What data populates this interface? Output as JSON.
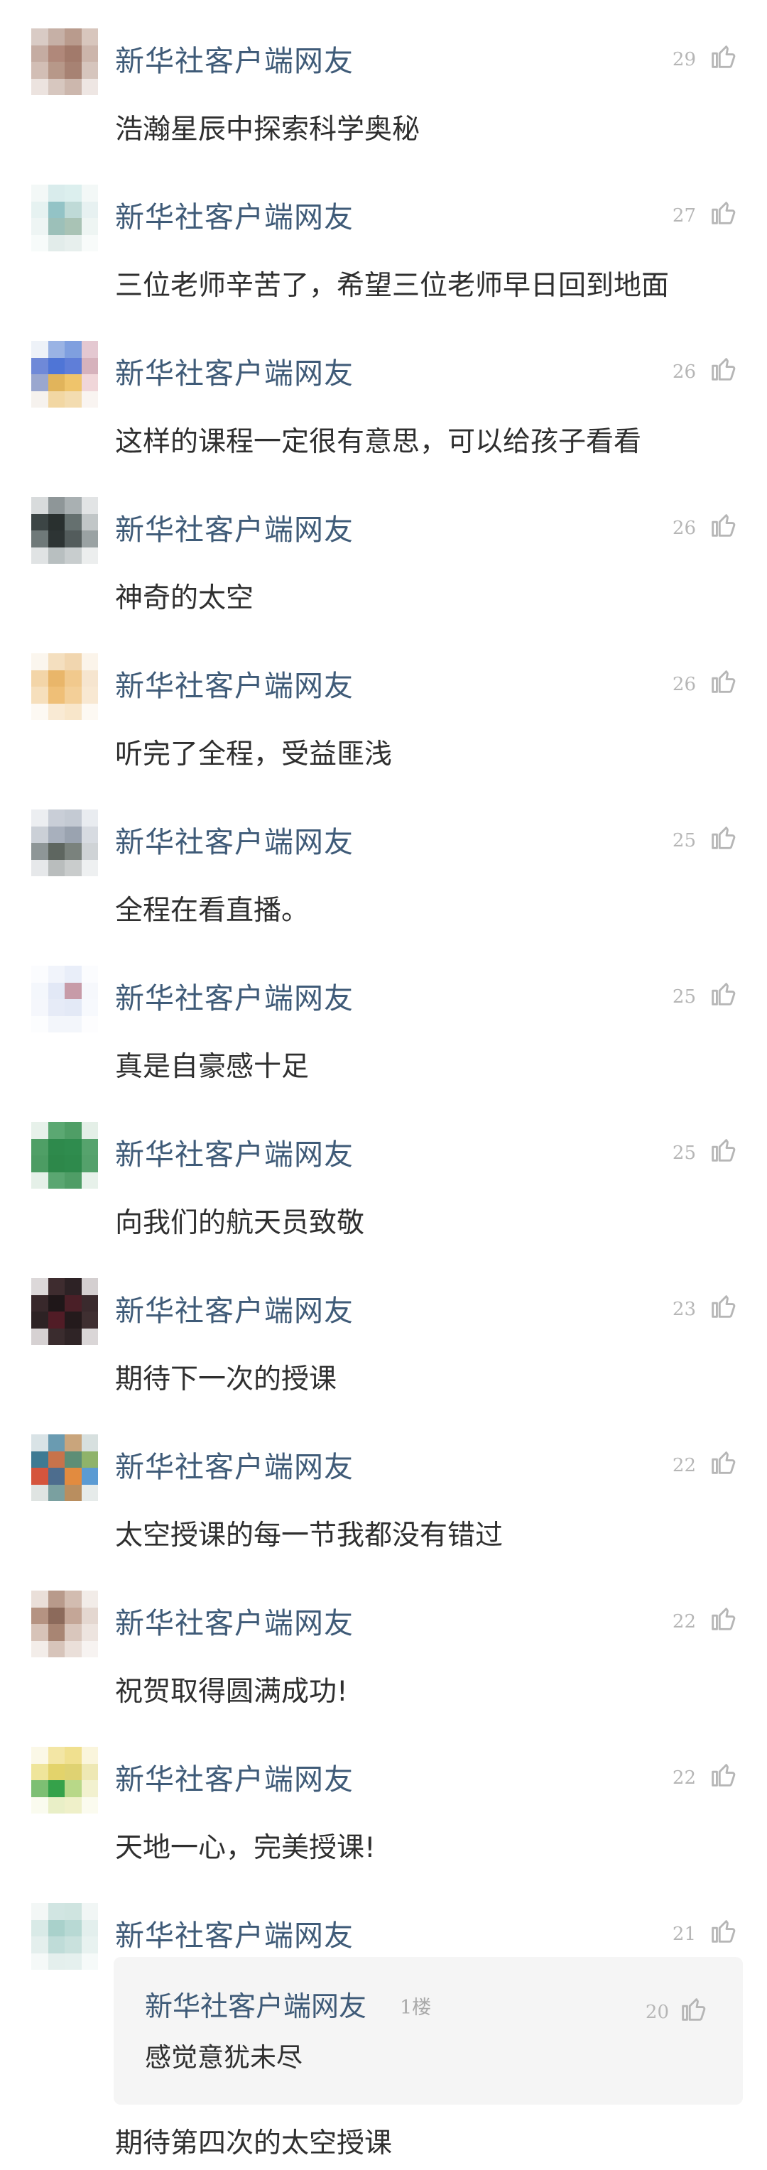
{
  "comments": [
    {
      "user": "新华社客户端网友",
      "likes": "29",
      "text": "浩瀚星辰中探索科学奥秘",
      "avatar_icon": "blurred-user-avatar",
      "avatar_colors": [
        "#d9cbc5",
        "#c6b0a6",
        "#b99b8d",
        "#d8c6bd",
        "#c5aca2",
        "#b0887a",
        "#a27a6b",
        "#ccb5ab",
        "#d2beb5",
        "#b79889",
        "#a78273",
        "#d6c5bd",
        "#ece3df",
        "#d7c7bf",
        "#ccb7ad",
        "#eee6e3"
      ]
    },
    {
      "user": "新华社客户端网友",
      "likes": "27",
      "text": "三位老师辛苦了，希望三位老师早日回到地面",
      "avatar_icon": "blurred-user-avatar",
      "avatar_colors": [
        "#f3f8f7",
        "#d9ecec",
        "#dcefee",
        "#f3f8f7",
        "#e6f2f1",
        "#93c3c6",
        "#bfdad7",
        "#e7f1f1",
        "#eef5f4",
        "#9cc0b9",
        "#a9c3b5",
        "#eef5f3",
        "#f7fbfa",
        "#e2ecea",
        "#e7efed",
        "#f8fbfa"
      ]
    },
    {
      "user": "新华社客户端网友",
      "likes": "26",
      "text": "这样的课程一定很有意思，可以给孩子看看",
      "avatar_icon": "blurred-user-avatar",
      "avatar_colors": [
        "#eef2f8",
        "#9ab3e4",
        "#7f9fdf",
        "#e4c8d1",
        "#6f89d8",
        "#4f75d6",
        "#5f7ed8",
        "#d6b2bc",
        "#9aa7cf",
        "#e1b45b",
        "#efc46b",
        "#f0d6d9",
        "#f6f2ee",
        "#f2d7a3",
        "#f3dcb0",
        "#f9f4f1"
      ]
    },
    {
      "user": "新华社客户端网友",
      "likes": "26",
      "text": "神奇的太空",
      "avatar_icon": "blurred-user-avatar",
      "avatar_colors": [
        "#d8dbdc",
        "#8e9698",
        "#a9b0b2",
        "#e2e4e5",
        "#3c4545",
        "#29302f",
        "#65706f",
        "#c1c6c7",
        "#6f7979",
        "#2d3434",
        "#535c5c",
        "#9aa2a3",
        "#e0e3e4",
        "#b8bfc0",
        "#c8cdce",
        "#eceeee"
      ]
    },
    {
      "user": "新华社客户端网友",
      "likes": "26",
      "text": "听完了全程，受益匪浅",
      "avatar_icon": "blurred-user-avatar",
      "avatar_colors": [
        "#fbf6ee",
        "#f4dfbf",
        "#f1d6af",
        "#fbf4ea",
        "#f3d5a8",
        "#e9b66a",
        "#f1c98d",
        "#f6e5cf",
        "#f6dfbc",
        "#efbf77",
        "#f3cf98",
        "#f8e8d2",
        "#fdf9f3",
        "#f9ead4",
        "#f8e6ca",
        "#fdf9f3"
      ]
    },
    {
      "user": "新华社客户端网友",
      "likes": "25",
      "text": "全程在看直播。",
      "avatar_icon": "blurred-user-avatar",
      "avatar_colors": [
        "#eceef1",
        "#c9ced7",
        "#c4cad3",
        "#e9ecf0",
        "#cbd0d7",
        "#a8b0bd",
        "#9aa3b0",
        "#d7dbe1",
        "#8e9697",
        "#5e6660",
        "#7a827d",
        "#cfd3d6",
        "#e6e8ea",
        "#b9bdbd",
        "#c9cccc",
        "#eef0f1"
      ]
    },
    {
      "user": "新华社客户端网友",
      "likes": "25",
      "text": "真是自豪感十足",
      "avatar_icon": "blurred-user-avatar",
      "avatar_colors": [
        "#fbfcfe",
        "#f1f4fb",
        "#e9eef9",
        "#fbfcfe",
        "#f4f7fc",
        "#e2e8f6",
        "#c79ba8",
        "#f6f8fc",
        "#f5f7fc",
        "#e6ebf7",
        "#e3e9f6",
        "#f7f9fd",
        "#fcfdfe",
        "#f3f6fb",
        "#f3f6fb",
        "#fdfdfe"
      ]
    },
    {
      "user": "新华社客户端网友",
      "likes": "25",
      "text": "向我们的航天员致敬",
      "avatar_icon": "blurred-user-avatar",
      "avatar_colors": [
        "#e7f1ea",
        "#5ba872",
        "#4f9e66",
        "#e4efe7",
        "#4f9f66",
        "#2e8a4c",
        "#2f8c4e",
        "#56a36d",
        "#4c9c63",
        "#2d884a",
        "#2e8a4c",
        "#54a16b",
        "#e5f0e8",
        "#5aa671",
        "#4f9d66",
        "#e7f1ea"
      ]
    },
    {
      "user": "新华社客户端网友",
      "likes": "23",
      "text": "期待下一次的授课",
      "avatar_icon": "blurred-user-avatar",
      "avatar_colors": [
        "#dcd8d9",
        "#3e2c2f",
        "#2d2225",
        "#d4cfd0",
        "#38282b",
        "#1f1719",
        "#4a1f27",
        "#3a2a2d",
        "#2d2224",
        "#511c26",
        "#241a1c",
        "#3f2f31",
        "#d6d1d2",
        "#3a2c2e",
        "#2f2426",
        "#dad6d7"
      ]
    },
    {
      "user": "新华社客户端网友",
      "likes": "22",
      "text": "太空授课的每一节我都没有错过",
      "avatar_icon": "blurred-user-avatar",
      "avatar_colors": [
        "#d9e3e6",
        "#6a9bb1",
        "#c9a57c",
        "#d7e0df",
        "#3e7a93",
        "#c7734b",
        "#5d8e76",
        "#8fb36a",
        "#d5553d",
        "#4d6d8e",
        "#e28b3f",
        "#5b9bd3",
        "#dfe4e2",
        "#7aa0a0",
        "#b98e5f",
        "#e6ebea"
      ]
    },
    {
      "user": "新华社客户端网友",
      "likes": "22",
      "text": "祝贺取得圆满成功!",
      "avatar_icon": "blurred-user-avatar",
      "avatar_colors": [
        "#eadfd9",
        "#b89a8b",
        "#d2bcb0",
        "#f2ece8",
        "#b59382",
        "#8c6a5b",
        "#c4a697",
        "#e4d7d0",
        "#d7c3b8",
        "#a88573",
        "#d9c6bc",
        "#ede4df",
        "#f3ede9",
        "#d7c4ba",
        "#eadfd9",
        "#f7f3f1"
      ]
    },
    {
      "user": "新华社客户端网友",
      "likes": "22",
      "text": "天地一心，完美授课!",
      "avatar_icon": "blurred-user-avatar",
      "avatar_colors": [
        "#fbf8e7",
        "#f3e6a5",
        "#f0e08f",
        "#faf5dc",
        "#efe59b",
        "#e3d36b",
        "#dfd272",
        "#eee8b4",
        "#7dbf73",
        "#35a24a",
        "#b8d888",
        "#f2f1cf",
        "#fafbef",
        "#e9efc7",
        "#eff0c9",
        "#fbfbef"
      ]
    },
    {
      "user": "新华社客户端网友",
      "likes": "21",
      "text": "",
      "avatar_icon": "blurred-user-avatar",
      "avatar_colors": [
        "#f3f7f6",
        "#d1e5e2",
        "#cfe4e0",
        "#f1f6f5",
        "#d9eae7",
        "#a9d1cb",
        "#b8d9d4",
        "#e3efed",
        "#e4efed",
        "#bfdcd8",
        "#c9e1dd",
        "#e8f2f0",
        "#f5f9f8",
        "#e4efed",
        "#e5f0ee",
        "#f6faf9"
      ]
    }
  ],
  "reply": {
    "user": "新华社客户端网友",
    "floor": "1楼",
    "likes": "20",
    "text": "感觉意犹未尽"
  },
  "final_comment_text": "期待第四次的太空授课",
  "colors": {
    "username": "#3f5b78",
    "text": "#2f2f2f",
    "like": "#b6b6b6",
    "reply_bg": "#f5f5f5"
  }
}
